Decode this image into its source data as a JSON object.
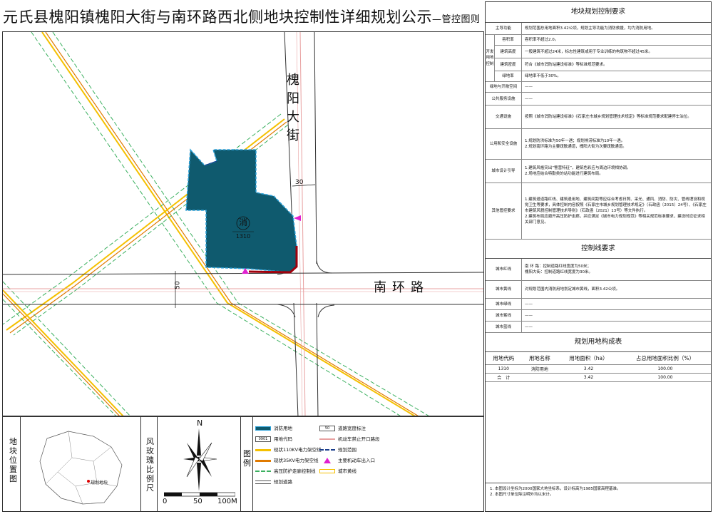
{
  "title": {
    "main": "元氏县槐阳镇槐阳大街与南环路西北侧地块控制性详细规划公示",
    "sub": "—管控图则"
  },
  "map": {
    "road_v_name": "槐阳大街",
    "road_h_name": "南环路",
    "road_v_width": "30",
    "road_h_width": "50",
    "plot_symbol": "消",
    "plot_code": "1310",
    "colors": {
      "plot": "#0f5a6e",
      "plot_border": "#2aa0d8",
      "boundary": "#a0000c",
      "yellow": "#f5c000",
      "orange": "#e07a00",
      "green": "#3cb060",
      "pink": "#e8a0a0",
      "entrance": "#e020d0"
    }
  },
  "bottom": {
    "location_label": "地块位置图",
    "location_marker": "规划地块",
    "rose_label": "风玫瑰比例尺",
    "north": "N",
    "scale": [
      "0",
      "50",
      "100M"
    ],
    "legend_label": "图例",
    "legend": [
      {
        "label": "消防用地",
        "icon": "fill-teal"
      },
      {
        "label": "用地代码",
        "code": "0901"
      },
      {
        "label": "现状110KV电力架空线",
        "icon": "line-yellow"
      },
      {
        "label": "现状35KV电力架空线",
        "icon": "line-orange"
      },
      {
        "label": "高压防护走廊控制线",
        "icon": "line-green-dash"
      },
      {
        "label": "规划道路",
        "icon": "line-road"
      },
      {
        "label": "道路宽度标注",
        "code": "50"
      },
      {
        "label": "机动车禁止开口路段",
        "icon": "line-red"
      },
      {
        "label": "规划范围",
        "icon": "line-blue-dash"
      },
      {
        "label": "主要机动车出入口",
        "icon": "triangle-magenta"
      },
      {
        "label": "城市黄线",
        "icon": "line-yellow-thin"
      }
    ]
  },
  "right": {
    "control_title": "地块规划控制要求",
    "main_func_k": "主导功能",
    "main_func_v": "规划范围总用地面积3.42公顷，规划主导功能为消防救援，均为消防用地。",
    "dev_group": "开发用地控制",
    "dev_rows": [
      {
        "k": "容积率",
        "v": "容积率不超过2.0。"
      },
      {
        "k": "建筑高度",
        "v": "一般建筑不超过24米，标志性建筑或用于专业训练的构筑物不超过45米。"
      },
      {
        "k": "建筑密度",
        "v": "符合《城市消防站建设标准》等标准规范要求。"
      },
      {
        "k": "绿地率",
        "v": "绿地率不低于30%。"
      }
    ],
    "rows": [
      {
        "k": "绿地与开敞空间",
        "v": "——"
      },
      {
        "k": "公共服务设施",
        "v": "——"
      },
      {
        "k": "交通设施",
        "v": "按照《城市消防站建设标准》《石家庄市城乡规划管理技术规定》等标准规范要求配建停车泊位。"
      },
      {
        "k": "公用和安全设施",
        "v": "1.规划防洪标准为50年一遇；规划排涝标准为10年一遇。\n2.规划南环路为主要疏散通道，槐阳大街为次要疏散通道。"
      },
      {
        "k": "城市设计引导",
        "v": "1.建筑风格突出“警营特征”，建筑色彩应与周边环境相协调。\n2.场地应结合特勤类的站功能进行建筑布局。"
      },
      {
        "k": "其他管控要求",
        "v": "1.建筑退道路红线、建筑退用地、建筑间距等应综合考虑日照、采光、通风、消防、防灾、管线埋设和视觉卫生等要求，具体控制内容按照《石家庄市城乡规划管理技术规定》（石政函〔2015〕24号）、《石家庄市建筑风貌控制管理技术导则》（石政函〔2021〕13号）等文件执行。\n2.建筑布局应避开高压防护走廊，并应满足《城市电力规划规范》等相关规范标准要求，建设时应征求相关部门意见。"
      }
    ],
    "line_title": "控制线要求",
    "line_rows": [
      {
        "k": "城市红线",
        "v": "南 环 路：控制道路红线宽度为50米；\n槐阳大街：控制道路红线宽度为30米。"
      },
      {
        "k": "城市黄线",
        "v": "对规划范围内消防用地划定城市黄线，面积3.42公顷。"
      },
      {
        "k": "城市绿线",
        "v": "——"
      },
      {
        "k": "城市紫线",
        "v": "——"
      },
      {
        "k": "城市蓝线",
        "v": "——"
      }
    ],
    "land_title": "规划用地构成表",
    "land_headers": [
      "用地代码",
      "用地名称",
      "用地面积（ha）",
      "占总用地面积比例（%）"
    ],
    "land_rows": [
      [
        "1310",
        "消防用地",
        "3.42",
        "100.00"
      ],
      [
        "合　计",
        "",
        "3.42",
        "100.00"
      ]
    ],
    "notes": [
      "1. 本图设计坐标为2000国家大地坐标系，设计标高为1985国家高程基准。",
      "2. 本图尺寸单位除注明外均以米计。"
    ]
  }
}
